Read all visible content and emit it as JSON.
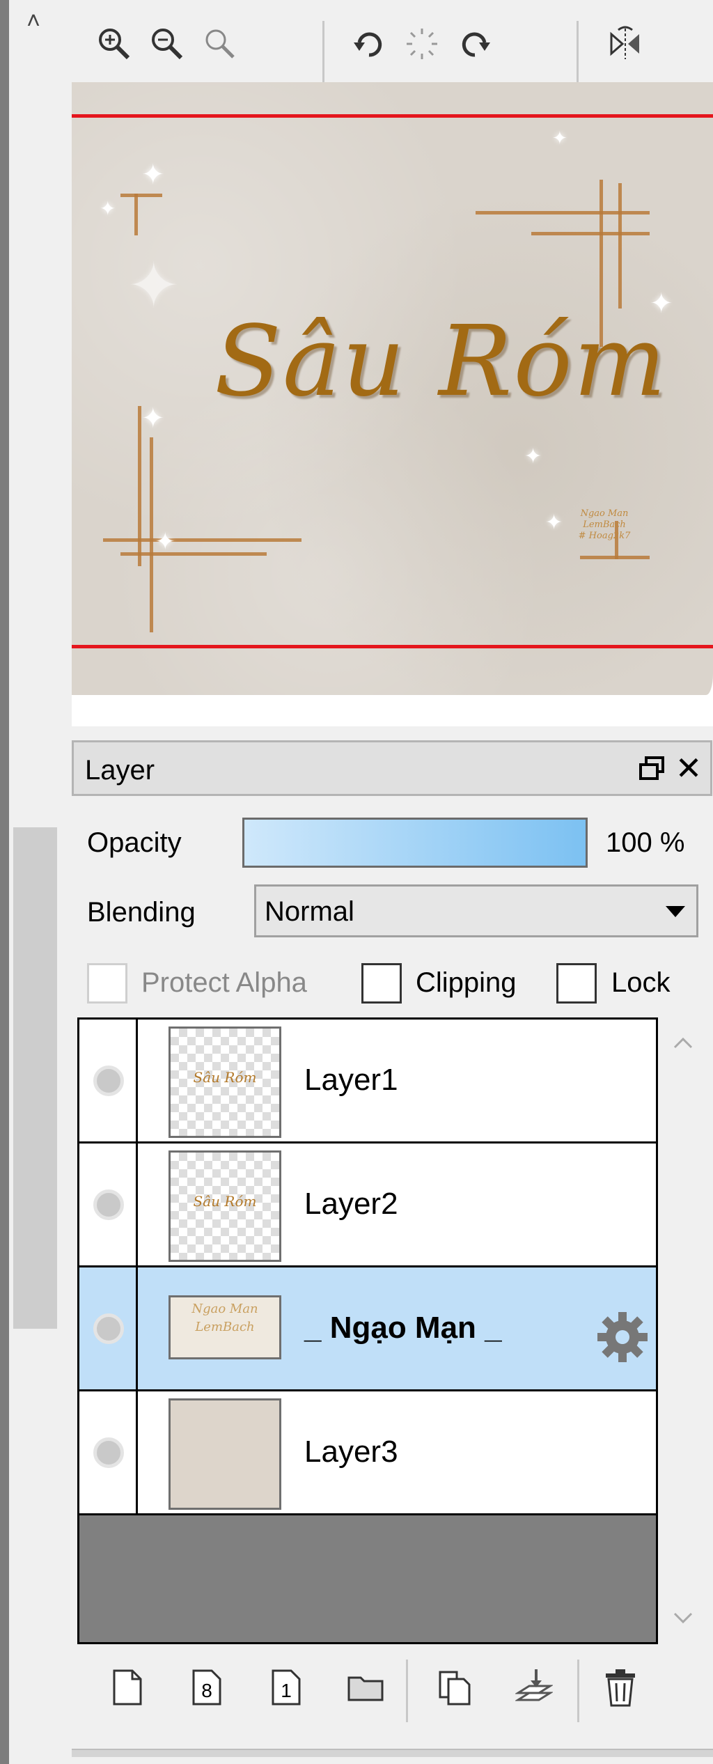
{
  "toolbar": {
    "buttons": [
      {
        "name": "zoom-in-icon"
      },
      {
        "name": "zoom-out-icon"
      },
      {
        "name": "zoom-reset-icon"
      },
      {
        "name": "rotate-left-icon"
      },
      {
        "name": "rotate-reset-icon"
      },
      {
        "name": "rotate-right-icon"
      },
      {
        "name": "flip-horizontal-icon"
      }
    ]
  },
  "canvas": {
    "artwork_title": "Sâu Róm",
    "artwork_signature": "Ngao Man\nLemBach\n# Hoag2k7"
  },
  "layer_panel": {
    "title": "Layer",
    "opacity_label": "Opacity",
    "opacity_value": "100 %",
    "opacity": 1.0,
    "blending_label": "Blending",
    "blending_value": "Normal",
    "protect_alpha_label": "Protect Alpha",
    "protect_alpha_checked": false,
    "protect_alpha_enabled": false,
    "clipping_label": "Clipping",
    "clipping_checked": false,
    "lock_label": "Lock",
    "lock_checked": false,
    "layers": [
      {
        "name": "Layer1",
        "selected": false,
        "thumb": "Sâu Róm"
      },
      {
        "name": "Layer2",
        "selected": false,
        "thumb": "Sâu Róm"
      },
      {
        "name": "_ Ngạo Mạn _",
        "selected": true,
        "has_settings": true
      },
      {
        "name": "Layer3",
        "selected": false
      }
    ]
  },
  "bottom_toolbar": {
    "buttons": [
      {
        "name": "new-layer-icon"
      },
      {
        "name": "new-8bit-layer-icon"
      },
      {
        "name": "new-1bit-layer-icon"
      },
      {
        "name": "new-folder-icon"
      },
      {
        "name": "duplicate-layer-icon"
      },
      {
        "name": "merge-down-icon"
      },
      {
        "name": "delete-layer-icon"
      }
    ]
  },
  "colors": {
    "selected_row": "#c0dff8",
    "guide_line": "#e5161d",
    "artwork_gold": "#a26a14"
  }
}
